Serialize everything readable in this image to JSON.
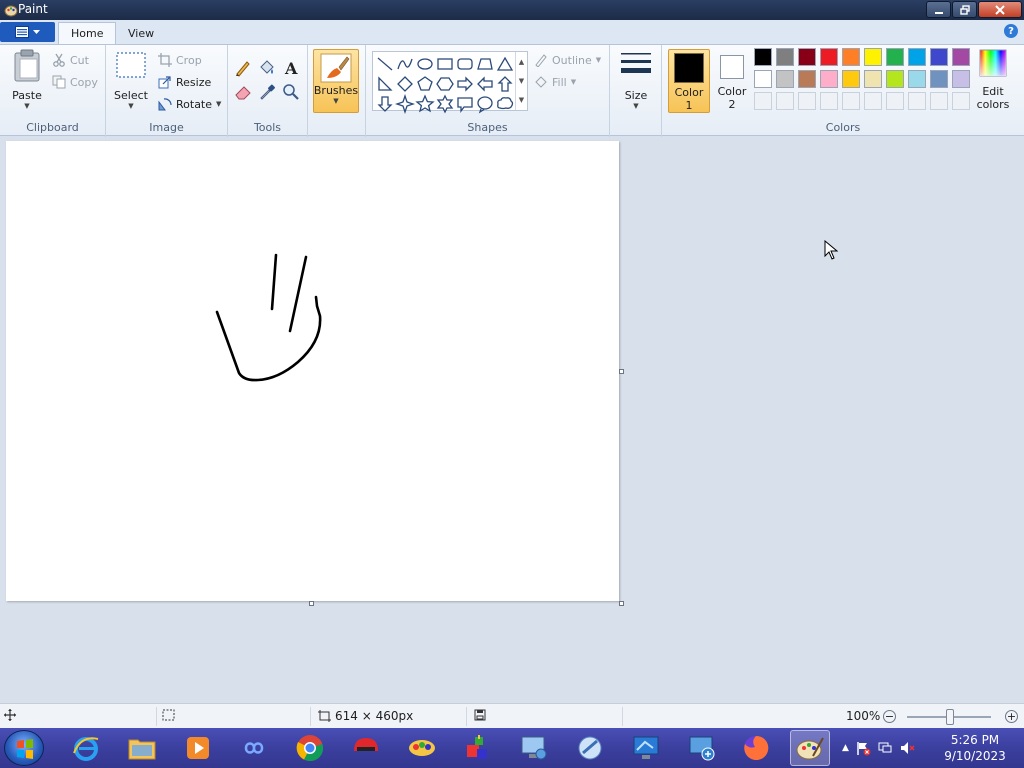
{
  "window": {
    "title": "Paint"
  },
  "ribbon": {
    "tabs": [
      {
        "label": "Home"
      },
      {
        "label": "View"
      }
    ],
    "clipboard": {
      "paste": "Paste",
      "cut": "Cut",
      "copy": "Copy",
      "group": "Clipboard"
    },
    "image": {
      "select": "Select",
      "crop": "Crop",
      "resize": "Resize",
      "rotate": "Rotate",
      "group": "Image"
    },
    "tools": {
      "group": "Tools"
    },
    "brushes": {
      "label": "Brushes"
    },
    "shapes": {
      "outline": "Outline",
      "fill": "Fill",
      "group": "Shapes"
    },
    "size": {
      "label": "Size"
    },
    "colors": {
      "color1_line1": "Color",
      "color1_line2": "1",
      "color2_line1": "Color",
      "color2_line2": "2",
      "edit_line1": "Edit",
      "edit_line2": "colors",
      "group": "Colors",
      "color1_value": "#000000",
      "color2_value": "#ffffff",
      "palette_row1": [
        "#000000",
        "#7f7f7f",
        "#880015",
        "#ed1c24",
        "#ff7f27",
        "#fff200",
        "#22b14c",
        "#00a2e8",
        "#3f48cc",
        "#a349a4"
      ],
      "palette_row2": [
        "#ffffff",
        "#c3c3c3",
        "#b97a57",
        "#ffaec9",
        "#ffc90e",
        "#efe4b0",
        "#b5e61d",
        "#99d9ea",
        "#7092be",
        "#c8bfe7"
      ]
    }
  },
  "statusbar": {
    "dimensions": "614 × 460px",
    "zoom": "100%"
  },
  "taskbar": {
    "time": "5:26 PM",
    "date": "9/10/2023"
  }
}
